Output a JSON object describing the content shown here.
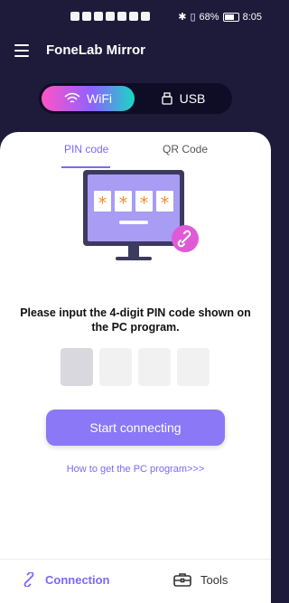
{
  "status_bar": {
    "battery": "68%",
    "time": "8:05"
  },
  "app_bar": {
    "title": "FoneLab Mirror"
  },
  "mode_toggle": {
    "wifi_label": "WiFi",
    "usb_label": "USB",
    "selected": "WiFi"
  },
  "tabs": [
    {
      "label": "PIN code",
      "active": true
    },
    {
      "label": "QR Code",
      "active": false
    }
  ],
  "illustration": {
    "pin_mask": [
      "*",
      "*",
      "*",
      "*"
    ]
  },
  "prompt": {
    "text": "Please input the 4-digit PIN code shown on the PC program."
  },
  "pin_input": {
    "digits": [
      "",
      "",
      "",
      ""
    ]
  },
  "connect_button": {
    "label": "Start connecting"
  },
  "help_link": {
    "text": "How to get the PC program>>>"
  },
  "bottom_nav": {
    "connection_label": "Connection",
    "tools_label": "Tools",
    "active": "Connection"
  },
  "colors": {
    "accent": "#7b68ff",
    "header_bg": "#1d1a3a",
    "button": "#8a78f6",
    "asterisk": "#f28a2c",
    "link_badge": "#e05ad8"
  }
}
